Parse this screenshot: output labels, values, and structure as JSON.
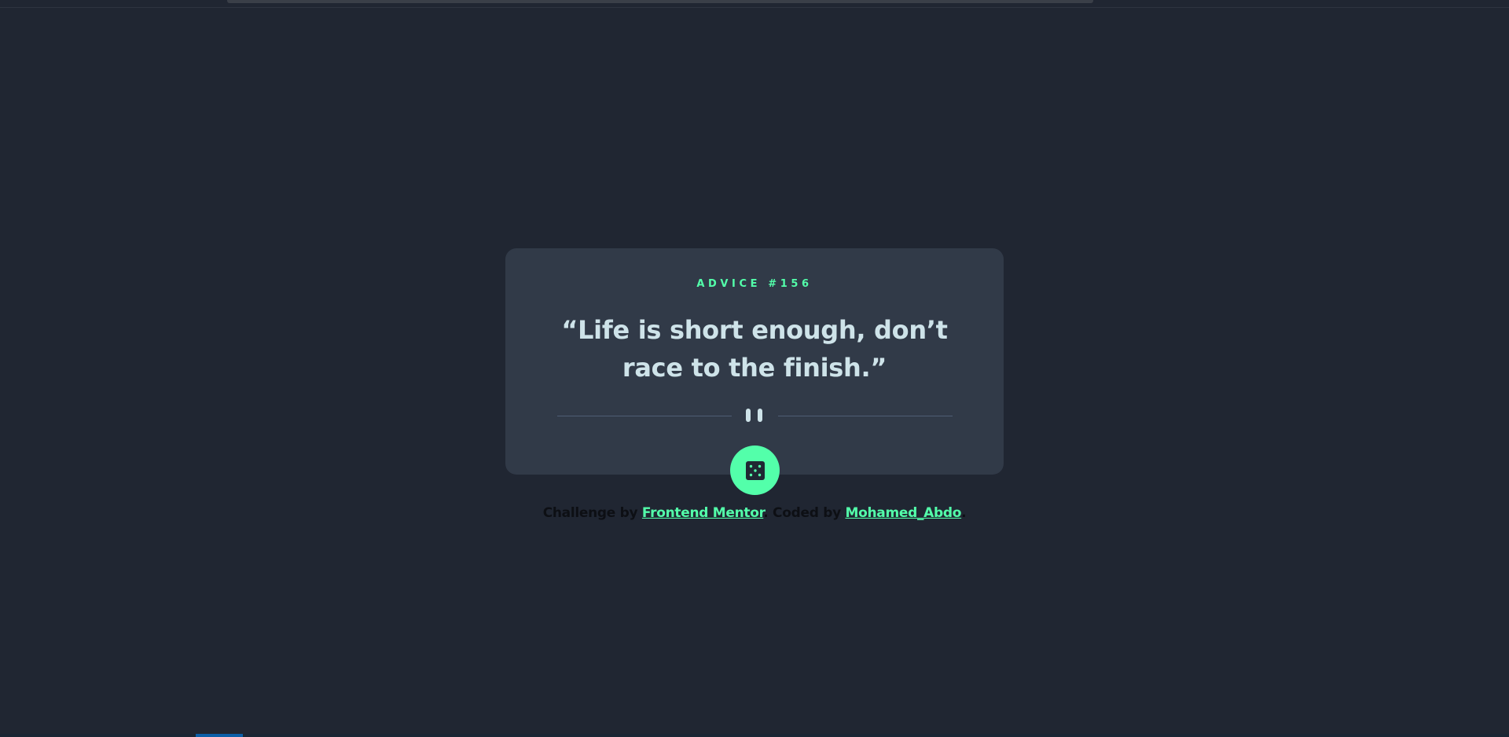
{
  "advice": {
    "label": "ADVICE #156",
    "quote": "“Life is short enough, don’t race to the finish.”"
  },
  "divider": {
    "icon": "pause-icon"
  },
  "dice_button": {
    "icon": "dice-icon"
  },
  "attribution": {
    "challenge_prefix": "Challenge by ",
    "challenge_link": "Frontend Mentor",
    "separator": ". Coded by ",
    "author_link": "Mohamed_Abdo",
    "suffix": "."
  },
  "colors": {
    "background": "#202632",
    "card": "#313a48",
    "accent": "#53ffaa",
    "quote_text": "#cee3e9",
    "divider": "#4f5d74"
  }
}
